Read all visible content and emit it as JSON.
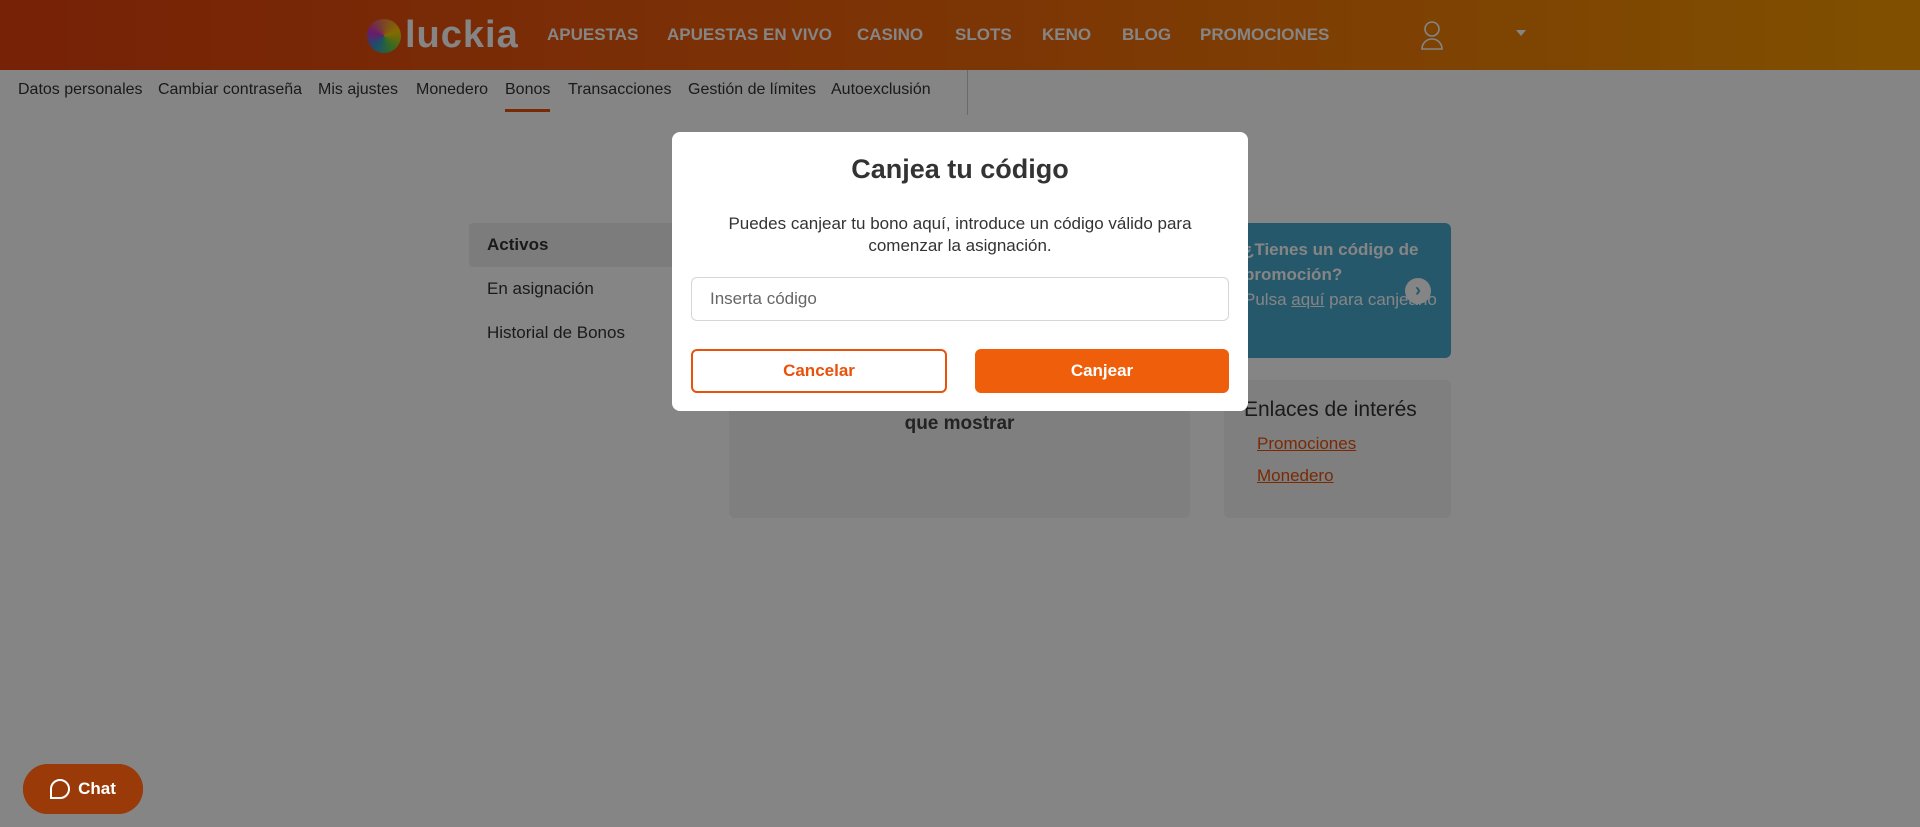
{
  "colors": {
    "brand": "#e8520a",
    "promo": "#4aa9cf"
  },
  "header": {
    "logo": "luckia",
    "nav": [
      "APUESTAS",
      "APUESTAS EN VIVO",
      "CASINO",
      "SLOTS",
      "KENO",
      "BLOG",
      "PROMOCIONES"
    ]
  },
  "subnav": {
    "items": [
      "Datos personales",
      "Cambiar contraseña",
      "Mis ajustes",
      "Monedero",
      "Bonos",
      "Transacciones",
      "Gestión de límites",
      "Autoexclusión"
    ],
    "active": "Bonos"
  },
  "sidebar": {
    "items": [
      "Activos",
      "En asignación",
      "Historial de Bonos"
    ]
  },
  "empty": {
    "text": "que mostrar"
  },
  "promo": {
    "title": "¿Tienes un código de promoción?",
    "pre": "Pulsa ",
    "link": "aquí",
    "post": " para canjearlo"
  },
  "links": {
    "title": "Enlaces de interés",
    "items": [
      "Promociones",
      "Monedero"
    ]
  },
  "chat": {
    "label": "Chat"
  },
  "modal": {
    "title": "Canjea tu código",
    "text": "Puedes canjear tu bono aquí, introduce un código válido para comenzar la asignación.",
    "placeholder": "Inserta código",
    "value": "",
    "cancel": "Cancelar",
    "submit": "Canjear"
  }
}
